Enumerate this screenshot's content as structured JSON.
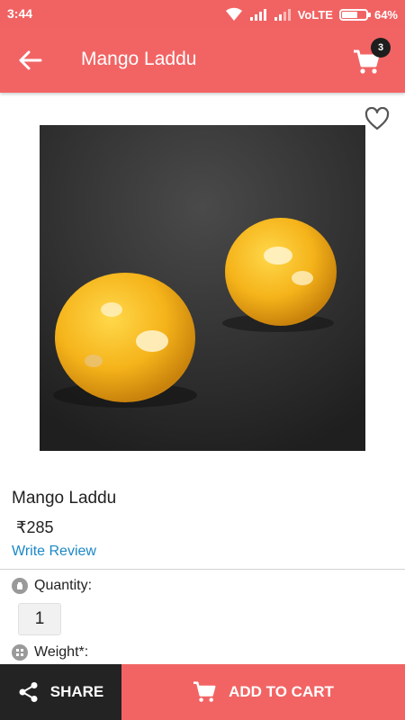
{
  "status_bar": {
    "time": "3:44",
    "network": "VoLTE",
    "battery_percent": "64%",
    "battery_level": 0.64
  },
  "header": {
    "title": "Mango Laddu",
    "cart_count": "3",
    "back_icon": "arrow-left-icon",
    "cart_icon": "shopping-cart-icon"
  },
  "product": {
    "name": "Mango Laddu",
    "price": "₹285",
    "write_review_label": "Write Review",
    "favorite_icon": "heart-outline-icon"
  },
  "options": {
    "quantity_label": "Quantity:",
    "quantity_value": "1",
    "weight_label": "Weight*:"
  },
  "bottom_bar": {
    "share_label": "SHARE",
    "add_to_cart_label": "ADD TO CART"
  },
  "colors": {
    "primary": "#f26464",
    "dark": "#232323",
    "link": "#1b88c6"
  }
}
